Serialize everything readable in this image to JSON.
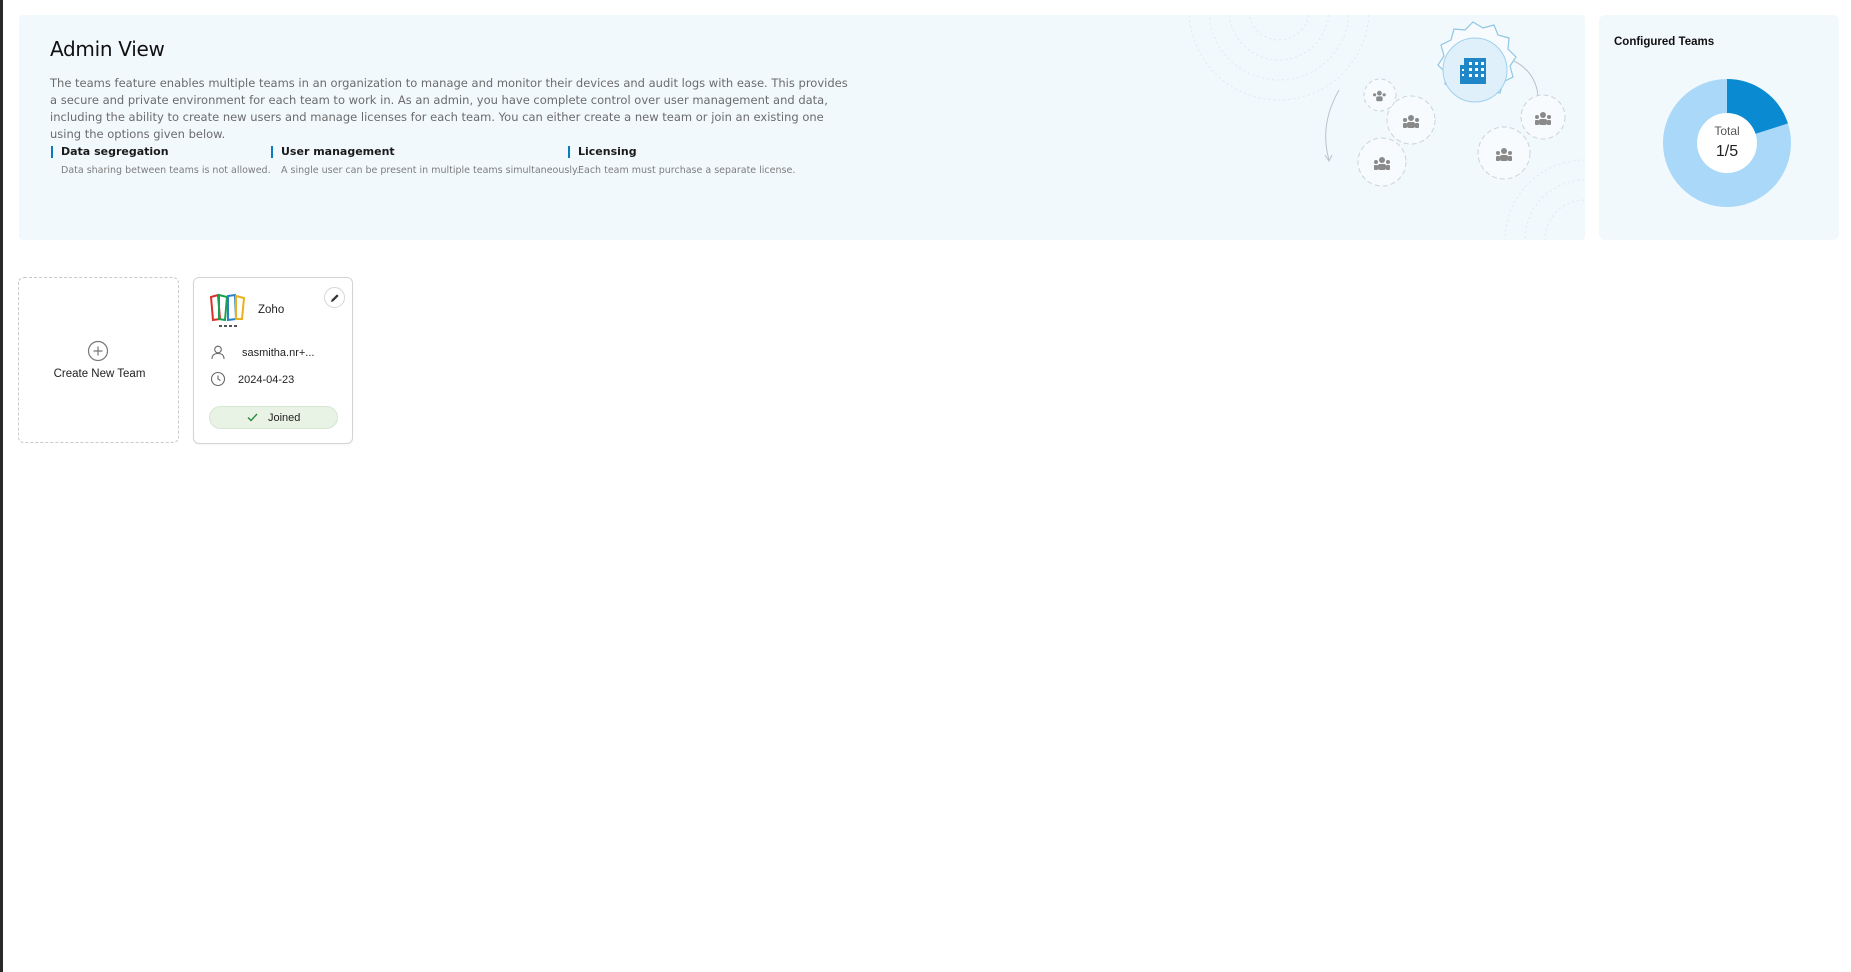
{
  "banner": {
    "title": "Admin View",
    "description": "The teams feature enables multiple teams in an organization to manage and monitor their devices and audit logs with ease. This provides a secure and private environment for each team to work in. As an admin, you have complete control over user management and data, including the ability to create new users and manage licenses for each team. You can either create a new team or join an existing one using the options given below.",
    "features": [
      {
        "title": "Data segregation",
        "text": "Data sharing between teams is not allowed."
      },
      {
        "title": "User management",
        "text": "A single user can be present in multiple teams simultaneously."
      },
      {
        "title": "Licensing",
        "text": "Each team must purchase a separate license."
      }
    ],
    "illustration_icons": [
      "gear-icon",
      "building-icon",
      "team-icon"
    ]
  },
  "configured_teams": {
    "title": "Configured Teams",
    "total_label": "Total",
    "total_value": "1/5",
    "used_fraction": 0.2,
    "colors": {
      "used": "#0a8ad0",
      "remaining": "#a9d8f8"
    }
  },
  "create_team": {
    "label": "Create New Team",
    "icon": "plus-circle-icon"
  },
  "teams": [
    {
      "name": "Zoho",
      "owner": "sasmitha.nr+...",
      "date": "2024-04-23",
      "status": "Joined",
      "icons": [
        "zoho-logo",
        "edit-icon",
        "user-icon",
        "clock-icon",
        "check-icon"
      ]
    }
  ],
  "colors": {
    "accent": "#0a7bbf",
    "banner_bg": "#f2f9fd",
    "joined_bg": "#e8f3e6"
  }
}
